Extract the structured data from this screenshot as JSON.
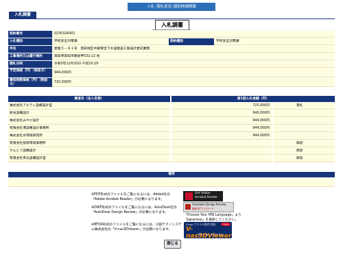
{
  "header": {
    "topbar": "入札･落札状況･個別詳細情報",
    "tab": "入札調書",
    "title": "入札調書"
  },
  "info": {
    "rows": [
      {
        "label": "契約番号",
        "value": "0230326401"
      },
      {
        "label": "入札種別",
        "value": "学校安全対策課",
        "label2": "契約種別",
        "value2": "学校安全対策課"
      },
      {
        "label": "件名",
        "value": "委第５－８１号　高知地区中部保全下水道建設工事設計委託業務"
      },
      {
        "label": "工事場所又は履行場所",
        "value": "高知県高知市朝倉甲532-22 他"
      },
      {
        "label": "開札日時",
        "value": "令和5年11月20日 午前10:29"
      },
      {
        "label": "予定価格（円）（税抜き）",
        "value": "944,000円"
      },
      {
        "label": "最低制限価格（円）（税抜き）",
        "value": "720,000円"
      }
    ]
  },
  "bids": {
    "headers": {
      "name": "業者名（法人名等）",
      "amount": "第1回入札金額（円）"
    },
    "rows": [
      {
        "name": "株式会社アルティ設備設計室",
        "amount": "725,000円",
        "result": "落札"
      },
      {
        "name": "新谷設備設計",
        "amount": "940,000円",
        "result": ""
      },
      {
        "name": "株式会社みやび設計",
        "amount": "944,000円",
        "result": ""
      },
      {
        "name": "有限会社港設備設計事務所",
        "amount": "944,000円",
        "result": ""
      },
      {
        "name": "株式会社水環境研究所",
        "amount": "944,000円",
        "result": ""
      },
      {
        "name": "有限会社技術環境事務所",
        "amount": "",
        "result": "辞退"
      },
      {
        "name": "せんとう設備設計",
        "amount": "",
        "result": "辞退"
      },
      {
        "name": "有限会社青北設備設計室",
        "amount": "",
        "result": "辞退"
      }
    ]
  },
  "notes": {
    "header": "備考",
    "body": ""
  },
  "downloads": {
    "pdf": "※PDF形式のファイルをご覧になるには、Adobe社の「Adobe Acrobat Reader」が必要になります。",
    "dwf": "※DWF形式のファイルをご覧になるには、AutoDesk社の「AutoDesk Design Review」が必要になります。",
    "lang": "「Choose Your MSI Language」より「Japanese」を選択してください。",
    "v3d": "※BFOX形式のファイルをご覧になるには、川田テクノシステム株式会社の「V-nas3DViewer」が必要になります。",
    "adobe_badge_1": "Get Adobe",
    "adobe_badge_2": "Acrobat Reader",
    "adr_badge_1": "Autodesk Design Review",
    "adr_badge_2": "無料ダウンロード",
    "v_badge_0": "V-nas ファイル形式 対応",
    "v_badge_free": "FREE",
    "v_badge_1": "V-nas3DViewer",
    "v_badge_2": "ダウンロードはこちら"
  },
  "footer": {
    "close": "閉じる"
  },
  "colors": {
    "navy": "#17357a",
    "cream": "#fffde0",
    "topbar": "#2d6fb7"
  }
}
